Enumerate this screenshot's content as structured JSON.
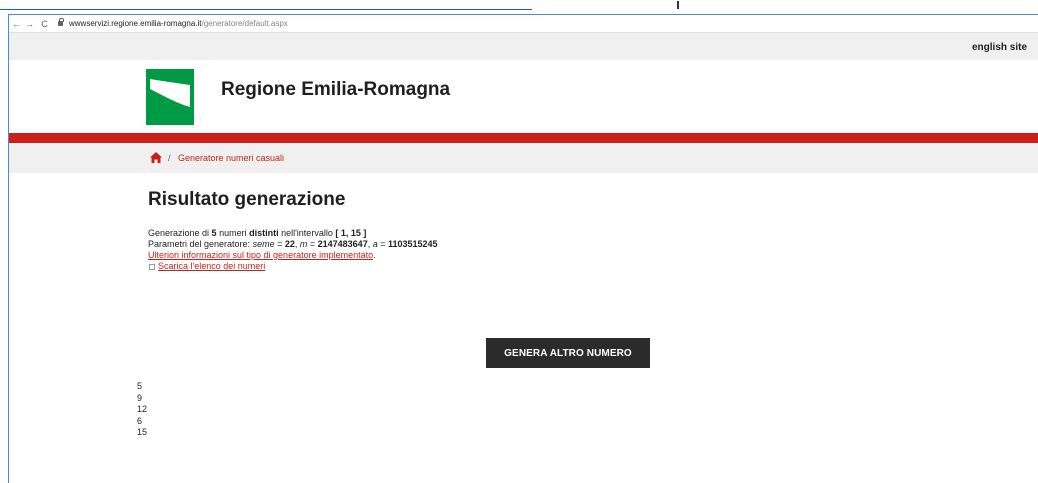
{
  "browser": {
    "back_label": "←",
    "forward_label": "→",
    "reload_label": "C",
    "url_host": "wwwservizi.regione.emilia-romagna.it",
    "url_path": "/generatore/default.aspx"
  },
  "topbar": {
    "english_link": "english site"
  },
  "header": {
    "title": "Regione Emilia-Romagna"
  },
  "breadcrumb": {
    "separator": "/",
    "current": "Generatore numeri casuali"
  },
  "main": {
    "heading": "Risultato generazione",
    "summary": {
      "prefix": "Generazione di ",
      "count": "5",
      "mid1": " numeri ",
      "distinct": "distinti",
      "mid2": " nell'intervallo ",
      "interval": "[ 1, 15 ]"
    },
    "params": {
      "prefix": "Parametri del generatore: ",
      "seme_label": "seme",
      "seme_value": "22",
      "m_label": "m",
      "m_value": "2147483647",
      "a_label": "a",
      "a_value": "1103515245",
      "eq": " = ",
      "comma": ", "
    },
    "info_link": "Ulteriori informazioni sul tipo di generatore implementato",
    "info_suffix": ".",
    "download_link": "Scarica l'elenco dei numeri"
  },
  "generate_button": "GENERA ALTRO NUMERO",
  "results": [
    "5",
    "9",
    "12",
    "6",
    "15"
  ],
  "colors": {
    "accent_red": "#cd1e19",
    "link_red": "#c6221c",
    "logo_green": "#009a44",
    "button_dark": "#2b2b2b"
  }
}
